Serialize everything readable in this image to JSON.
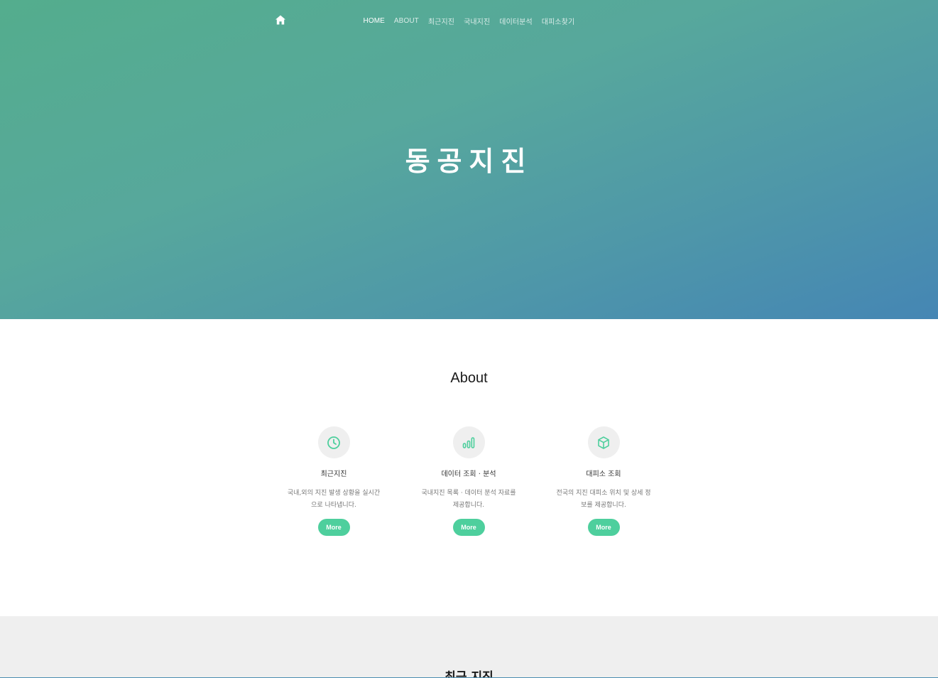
{
  "nav": {
    "home_icon": "home-icon",
    "links": [
      {
        "label": "HOME",
        "active": true
      },
      {
        "label": "ABOUT",
        "active": false
      },
      {
        "label": "최근지진",
        "active": false
      },
      {
        "label": "국내지진",
        "active": false
      },
      {
        "label": "데이터분석",
        "active": false
      },
      {
        "label": "대피소찾기",
        "active": false
      }
    ]
  },
  "hero": {
    "title": "동공지진",
    "gradient": [
      "#54ad8d",
      "#4586b4"
    ]
  },
  "about": {
    "title": "About",
    "features": [
      {
        "icon": "clock-icon",
        "title": "최근지진",
        "desc_line1": "국내,외의 지진 발생 상황을 실시간",
        "desc_line2": "으로 나타냅니다.",
        "button": "More"
      },
      {
        "icon": "bar-chart-icon",
        "title": "데이터 조회 · 분석",
        "desc_line1": "국내지진 목록 · 데이터 분석 자료를",
        "desc_line2": "제공합니다.",
        "button": "More"
      },
      {
        "icon": "box-icon",
        "title": "대피소 조회",
        "desc_line1": "전국의 지진 대피소 위치 및 상세 정",
        "desc_line2": "보를 제공합니다.",
        "button": "More"
      }
    ]
  },
  "recent": {
    "title": "최근 지진"
  },
  "colors": {
    "accent": "#4ecf9d",
    "icon_bg": "#efefef",
    "section_bg": "#efefef"
  }
}
